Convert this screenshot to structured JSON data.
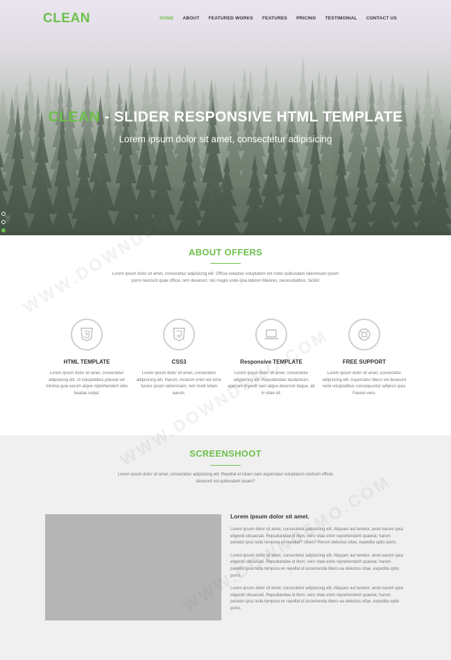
{
  "nav": {
    "logo": "CLEAN",
    "items": [
      {
        "label": "HOME",
        "active": true
      },
      {
        "label": "ABOUT",
        "active": false
      },
      {
        "label": "FEATURED WORKS",
        "active": false
      },
      {
        "label": "FEATURES",
        "active": false
      },
      {
        "label": "PRICING",
        "active": false
      },
      {
        "label": "TESTIMONIAL",
        "active": false
      },
      {
        "label": "CONTACT US",
        "active": false
      }
    ]
  },
  "hero": {
    "title_accent": "CLEAN",
    "title_rest": " - SLIDER RESPONSIVE HTML TEMPLATE",
    "subtitle": "Lorem ipsum dolor sit amet, consectetur adipisicing"
  },
  "about": {
    "title": "ABOUT OFFERS",
    "desc": "Lorem ipsum dolor sit amet, consectetur adipisicing elit. Officia voluptas voluptatem est nobis quibusdam laboriosam ipsum porro nesciunt quae officia, rem deserunt, nisi magni unde ipsa labore! Maiores, necessitatibus, facilis!",
    "features": [
      {
        "icon": "html5-icon",
        "title": "HTML TEMPLATE",
        "text": "Lorem ipsum dolor sit amet, consectetur adipisicing elit. Id voluptatibus placeat vel minima quia earum atque reprehenderit odio beatae culpa!"
      },
      {
        "icon": "css3-icon",
        "title": "CSS3",
        "text": "Lorem ipsum dolor sit amet, consectetur adipisicing elit. Harum, nostrum enim est error facere ipsum laboriosam, rem modi totam earum."
      },
      {
        "icon": "laptop-icon",
        "title": "Responsive TEMPLATE",
        "text": "Lorem ipsum dolor sit amet, consectetur adipisicing elit. Repudiandae laudantium, aperiam impedit nam atque deserunt itaque, ab in vitae sit."
      },
      {
        "icon": "support-icon",
        "title": "FREE SUPPORT",
        "text": "Lorem ipsum dolor sit amet, consectetur adipisicing elit. Aspernatur libero vel deserunt nulla voluptatibus consequuntur adipisci quia. Facere vero."
      }
    ]
  },
  "screenshoot": {
    "title": "SCREENSHOOT",
    "desc": "Lorem ipsum dolor sit amet, consectetur adipisicing elit. Repellat et totam nam aspernatur voluptatum nostrum officiis deserunt est quibusdam ipsam?",
    "heading": "Lorem ipsum dolor sit amet.",
    "paragraphs": [
      "Lorem ipsum dolor sit amet, consectetur adipisicing elit. Aliquam aut tenetur, amet earum quia eligendi obcaecati. Repudiandae id illum, vero vitae enim reprehenderit quaerat, harum pariatur ipsa nulla tempora ex repellat? Ullam? Rerum delectus vitae, expedita optio porro.",
      "Lorem ipsum dolor sit amet, consectetur adipisicing elit. Aliquam aut tenetur, amet earum quia eligendi obcaecati. Repudiandae id illum, vero vitae enim reprehenderit quaerat, harum pariatur ipsa nulla tempora ex repellat id assumenda libero ea delectus vitae, expedita optio porro.",
      "Lorem ipsum dolor sit amet, consectetur adipisicing elit. Aliquam aut tenetur, amet earum quia eligendi obcaecati. Repudiandae id illum, vero vitae enim reprehenderit quaerat, harum pariatur ipsa nulla tempora ex repellat id assumenda libero ea delectus vitae, expedita optio porro."
    ]
  },
  "watermark": "WWW.DOWNDEMO.COM",
  "colors": {
    "accent": "#6cc04a",
    "section_bg": "#f0f0f0",
    "placeholder": "#b5b5b5"
  }
}
